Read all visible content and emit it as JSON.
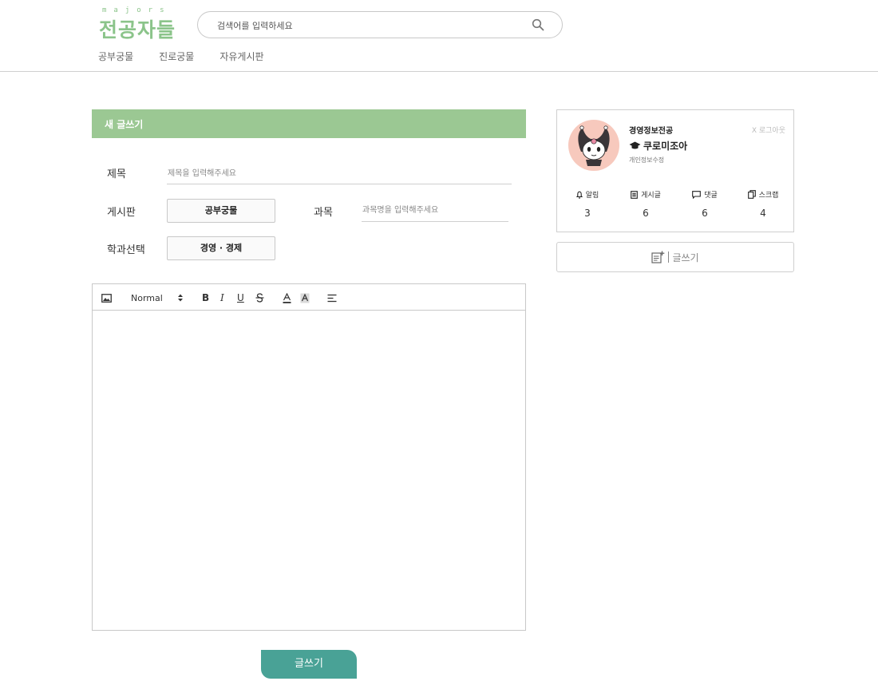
{
  "header": {
    "logo_small": "majors",
    "logo_main": "전공자들",
    "search_placeholder": "검색어를 입력하세요",
    "nav": [
      "공부궁물",
      "진로궁물",
      "자유게시판"
    ]
  },
  "write": {
    "title": "새 글쓰기",
    "subject_label": "제목",
    "subject_placeholder": "제목을 입력해주세요",
    "board_label": "게시판",
    "board_value": "공부궁물",
    "course_label": "과목",
    "course_placeholder": "과목명을 입력해주세요",
    "dept_label": "학과선택",
    "dept_value": "경영 · 경제",
    "toolbar": {
      "format": "Normal",
      "bold": "B",
      "italic": "I",
      "underline": "U"
    },
    "submit_label": "글쓰기"
  },
  "profile": {
    "major": "경영정보전공",
    "logout": "X 로그아웃",
    "nickname": "쿠로미조아",
    "edit": "개인정보수정",
    "stats": [
      {
        "label": "알림",
        "value": "3",
        "icon": "bell-icon"
      },
      {
        "label": "게시글",
        "value": "6",
        "icon": "post-icon"
      },
      {
        "label": "댓글",
        "value": "6",
        "icon": "comment-icon"
      },
      {
        "label": "스크랩",
        "value": "4",
        "icon": "scrap-icon"
      }
    ],
    "write_button": "글쓰기"
  },
  "colors": {
    "brand": "#8bc48a",
    "header_bar": "#9bc893",
    "submit": "#49a296"
  }
}
